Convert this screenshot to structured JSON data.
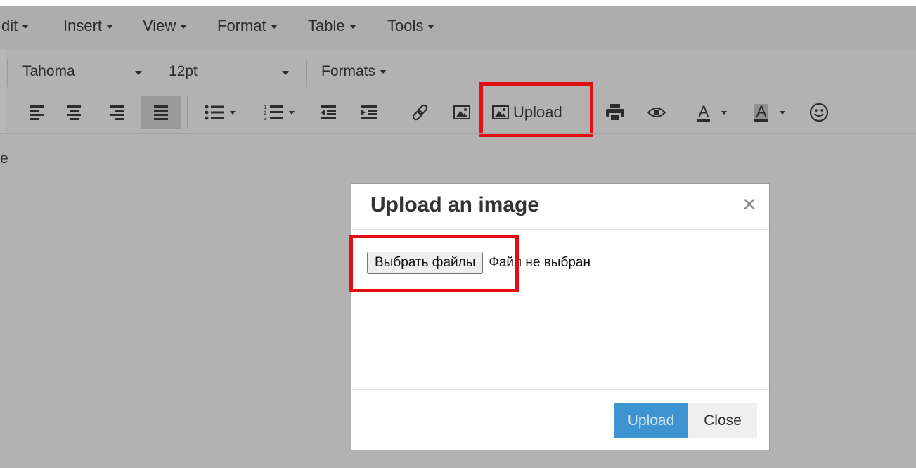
{
  "menubar": {
    "items": [
      {
        "label": "dit"
      },
      {
        "label": "Insert"
      },
      {
        "label": "View"
      },
      {
        "label": "Format"
      },
      {
        "label": "Table"
      },
      {
        "label": "Tools"
      }
    ]
  },
  "toolbar": {
    "font_family": "Tahoma",
    "font_size": "12pt",
    "formats_label": "Formats",
    "upload_label": "Upload",
    "forecolor_letter": "A",
    "backcolor_letter": "A"
  },
  "editor": {
    "content": "e"
  },
  "dialog": {
    "title": "Upload an image",
    "close_glyph": "×",
    "file_button": "Выбрать файлы",
    "file_status": "Файл не выбран",
    "upload_button": "Upload",
    "close_button": "Close"
  },
  "colors": {
    "highlight": "#e10f0f",
    "primary": "#3e93d2"
  },
  "icons": [
    "align-left-icon",
    "align-center-icon",
    "align-right-icon",
    "align-justify-icon",
    "bullet-list-icon",
    "numbered-list-icon",
    "outdent-icon",
    "indent-icon",
    "link-icon",
    "image-icon",
    "print-icon",
    "preview-icon",
    "emoticon-icon",
    "close-icon"
  ]
}
